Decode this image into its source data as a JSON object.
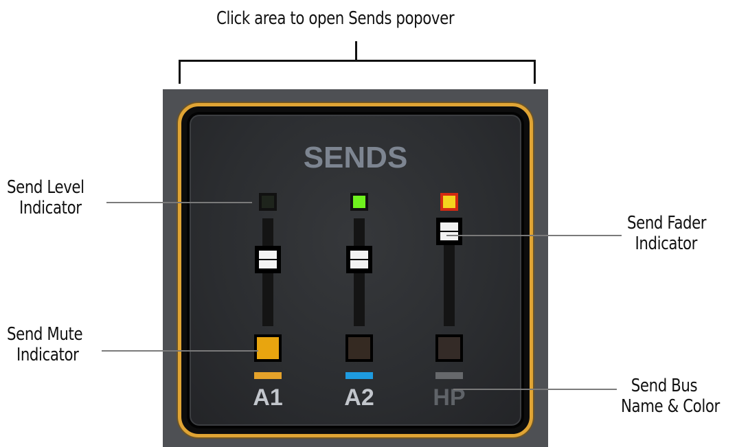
{
  "header": {
    "callout": "Click area to open Sends popover"
  },
  "callouts": {
    "send_level": [
      "Send Level",
      "Indicator"
    ],
    "send_mute": [
      "Send Mute",
      "Indicator"
    ],
    "send_fader": [
      "Send Fader",
      "Indicator"
    ],
    "send_bus": [
      "Send Bus",
      "Name & Color"
    ]
  },
  "panel": {
    "title": "SENDS",
    "channels": [
      {
        "bus": "A1",
        "bus_color": "#e5a22a",
        "name_color": "#c2c6cc",
        "led_color": "#1e241c",
        "mute_color": "#e8a50f",
        "muted": true,
        "fader_level": 0.62
      },
      {
        "bus": "A2",
        "bus_color": "#1e9be0",
        "name_color": "#c2c6cc",
        "led_color": "#6ff21e",
        "mute_color": "#352a22",
        "muted": false,
        "fader_level": 0.62
      },
      {
        "bus": "HP",
        "bus_color": "#67696c",
        "name_color": "#5f6368",
        "led_color": "#f4d41e",
        "led_border": "#d42a12",
        "mute_color": "#342b27",
        "muted": false,
        "fader_level": 0.88
      }
    ]
  }
}
